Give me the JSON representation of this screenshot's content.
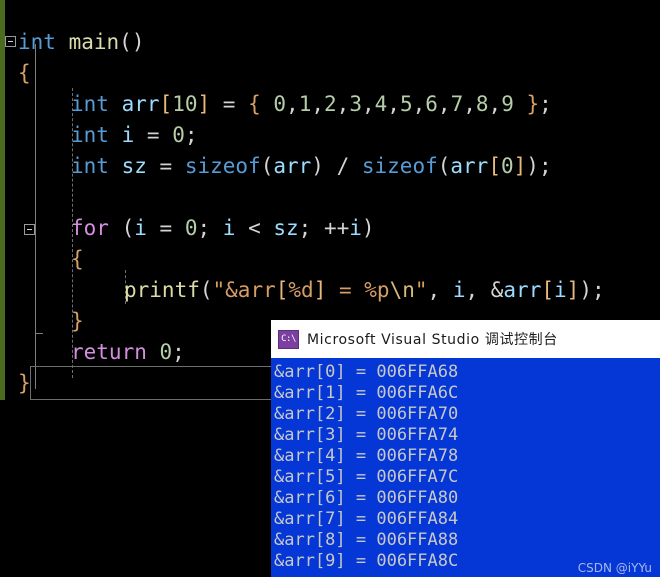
{
  "editor": {
    "background": "#000000",
    "change_bar_color": "#4a6b20",
    "lines": [
      {
        "indent": 0,
        "tokens": [
          {
            "t": "int",
            "c": "kw"
          },
          {
            "t": " ",
            "c": "op"
          },
          {
            "t": "main",
            "c": "fn"
          },
          {
            "t": "()",
            "c": "op"
          }
        ]
      },
      {
        "indent": 1,
        "tokens": [
          {
            "t": "{",
            "c": "brace"
          }
        ]
      },
      {
        "indent": 2,
        "tokens": [
          {
            "t": "int",
            "c": "kw"
          },
          {
            "t": " ",
            "c": "op"
          },
          {
            "t": "arr",
            "c": "id"
          },
          {
            "t": "[",
            "c": "brk"
          },
          {
            "t": "10",
            "c": "num"
          },
          {
            "t": "]",
            "c": "brk"
          },
          {
            "t": " = ",
            "c": "op"
          },
          {
            "t": "{",
            "c": "brace"
          },
          {
            "t": " ",
            "c": "op"
          },
          {
            "t": "0",
            "c": "num"
          },
          {
            "t": ",",
            "c": "op"
          },
          {
            "t": "1",
            "c": "num"
          },
          {
            "t": ",",
            "c": "op"
          },
          {
            "t": "2",
            "c": "num"
          },
          {
            "t": ",",
            "c": "op"
          },
          {
            "t": "3",
            "c": "num"
          },
          {
            "t": ",",
            "c": "op"
          },
          {
            "t": "4",
            "c": "num"
          },
          {
            "t": ",",
            "c": "op"
          },
          {
            "t": "5",
            "c": "num"
          },
          {
            "t": ",",
            "c": "op"
          },
          {
            "t": "6",
            "c": "num"
          },
          {
            "t": ",",
            "c": "op"
          },
          {
            "t": "7",
            "c": "num"
          },
          {
            "t": ",",
            "c": "op"
          },
          {
            "t": "8",
            "c": "num"
          },
          {
            "t": ",",
            "c": "op"
          },
          {
            "t": "9",
            "c": "num"
          },
          {
            "t": " ",
            "c": "op"
          },
          {
            "t": "}",
            "c": "brace"
          },
          {
            "t": ";",
            "c": "op"
          }
        ]
      },
      {
        "indent": 2,
        "tokens": [
          {
            "t": "int",
            "c": "kw"
          },
          {
            "t": " ",
            "c": "op"
          },
          {
            "t": "i",
            "c": "id"
          },
          {
            "t": " = ",
            "c": "op"
          },
          {
            "t": "0",
            "c": "num"
          },
          {
            "t": ";",
            "c": "op"
          }
        ]
      },
      {
        "indent": 2,
        "tokens": [
          {
            "t": "int",
            "c": "kw"
          },
          {
            "t": " ",
            "c": "op"
          },
          {
            "t": "sz",
            "c": "id"
          },
          {
            "t": " = ",
            "c": "op"
          },
          {
            "t": "sizeof",
            "c": "kw"
          },
          {
            "t": "(",
            "c": "op"
          },
          {
            "t": "arr",
            "c": "id"
          },
          {
            "t": ")",
            "c": "op"
          },
          {
            "t": " / ",
            "c": "op"
          },
          {
            "t": "sizeof",
            "c": "kw"
          },
          {
            "t": "(",
            "c": "op"
          },
          {
            "t": "arr",
            "c": "id"
          },
          {
            "t": "[",
            "c": "brk"
          },
          {
            "t": "0",
            "c": "num"
          },
          {
            "t": "]",
            "c": "brk"
          },
          {
            "t": ")",
            "c": "op"
          },
          {
            "t": ";",
            "c": "op"
          }
        ]
      },
      {
        "indent": 2,
        "tokens": []
      },
      {
        "indent": 2,
        "tokens": [
          {
            "t": "for",
            "c": "ctrl"
          },
          {
            "t": " (",
            "c": "op"
          },
          {
            "t": "i",
            "c": "id"
          },
          {
            "t": " = ",
            "c": "op"
          },
          {
            "t": "0",
            "c": "num"
          },
          {
            "t": "; ",
            "c": "op"
          },
          {
            "t": "i",
            "c": "id"
          },
          {
            "t": " < ",
            "c": "op"
          },
          {
            "t": "sz",
            "c": "id"
          },
          {
            "t": "; ++",
            "c": "op"
          },
          {
            "t": "i",
            "c": "id"
          },
          {
            "t": ")",
            "c": "op"
          }
        ]
      },
      {
        "indent": 3,
        "tokens": [
          {
            "t": "{",
            "c": "brace"
          }
        ]
      },
      {
        "indent": 4,
        "tokens": [
          {
            "t": "printf",
            "c": "fn"
          },
          {
            "t": "(",
            "c": "op"
          },
          {
            "t": "\"&arr",
            "c": "str"
          },
          {
            "t": "[",
            "c": "brk"
          },
          {
            "t": "%d",
            "c": "str"
          },
          {
            "t": "]",
            "c": "brk"
          },
          {
            "t": " = %p",
            "c": "str"
          },
          {
            "t": "\\n",
            "c": "esc"
          },
          {
            "t": "\"",
            "c": "str"
          },
          {
            "t": ", ",
            "c": "op"
          },
          {
            "t": "i",
            "c": "id"
          },
          {
            "t": ", &",
            "c": "op"
          },
          {
            "t": "arr",
            "c": "id"
          },
          {
            "t": "[",
            "c": "brk"
          },
          {
            "t": "i",
            "c": "id"
          },
          {
            "t": "]",
            "c": "brk"
          },
          {
            "t": ")",
            "c": "op"
          },
          {
            "t": ";",
            "c": "op"
          }
        ]
      },
      {
        "indent": 3,
        "tokens": [
          {
            "t": "}",
            "c": "brace"
          }
        ]
      },
      {
        "indent": 2,
        "tokens": [
          {
            "t": "return",
            "c": "ctrl"
          },
          {
            "t": " ",
            "c": "op"
          },
          {
            "t": "0",
            "c": "num"
          },
          {
            "t": ";",
            "c": "op"
          }
        ]
      },
      {
        "indent": 1,
        "tokens": [
          {
            "t": "}",
            "c": "brace"
          }
        ]
      }
    ]
  },
  "console": {
    "icon_label": "C:\\",
    "icon_color": "#7b3fa0",
    "title": "Microsoft Visual Studio 调试控制台",
    "titlebar_background": "#ffffff",
    "body_background": "#0437d6",
    "text_color": "#c8c8c8",
    "output_lines": [
      "&arr[0] = 006FFA68",
      "&arr[1] = 006FFA6C",
      "&arr[2] = 006FFA70",
      "&arr[3] = 006FFA74",
      "&arr[4] = 006FFA78",
      "&arr[5] = 006FFA7C",
      "&arr[6] = 006FFA80",
      "&arr[7] = 006FFA84",
      "&arr[8] = 006FFA88",
      "&arr[9] = 006FFA8C"
    ],
    "watermark": "CSDN @iYYu"
  }
}
